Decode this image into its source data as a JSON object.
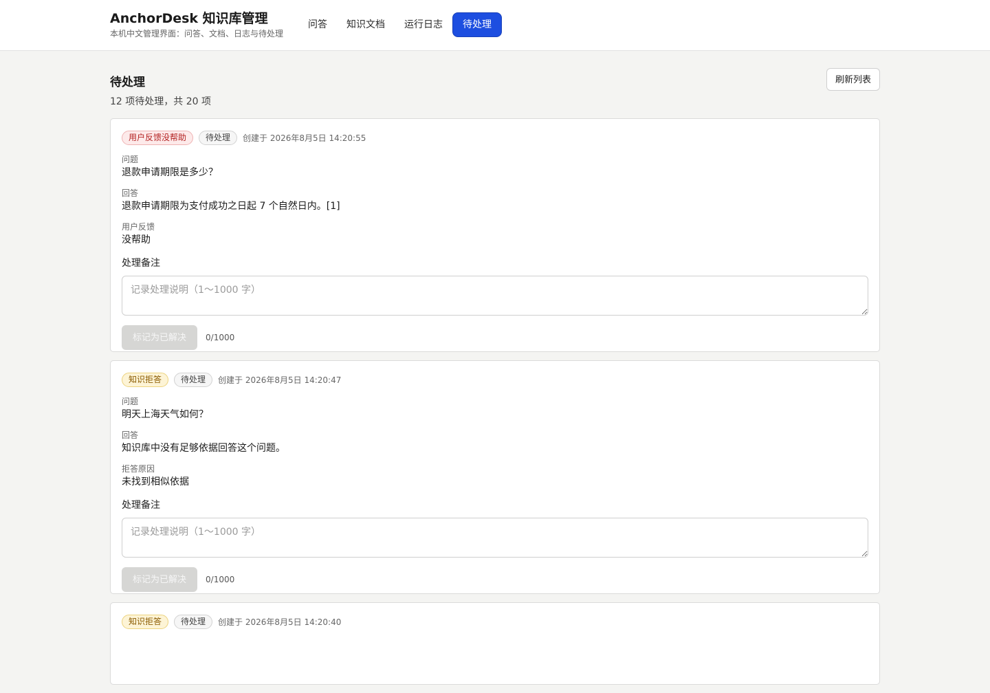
{
  "header": {
    "title": "AnchorDesk 知识库管理",
    "subtitle": "本机中文管理界面：问答、文档、日志与待处理",
    "tabs": [
      {
        "label": "问答",
        "active": false
      },
      {
        "label": "知识文档",
        "active": false
      },
      {
        "label": "运行日志",
        "active": false
      },
      {
        "label": "待处理",
        "active": true
      }
    ],
    "accent_color": "#1d4ee0"
  },
  "page": {
    "title": "待处理",
    "count_text": "12 项待处理，共 20 项",
    "refresh_label": "刷新列表"
  },
  "items": [
    {
      "type_badge": "用户反馈没帮助",
      "type_color": "red",
      "status_badge": "待处理",
      "created": "创建于 2026年8月5日 14:20:55",
      "question_label": "问题",
      "question": "退款申请期限是多少？",
      "answer_label": "回答",
      "answer": "退款申请期限为支付成功之日起 7 个自然日内。[1]",
      "extra_label": "用户反馈",
      "extra": "没帮助",
      "note_label": "处理备注",
      "note_placeholder": "记录处理说明（1～1000 字）",
      "note_value": "",
      "resolve_label": "标记为已解决",
      "char_count": "0/1000"
    },
    {
      "type_badge": "知识拒答",
      "type_color": "yellow",
      "status_badge": "待处理",
      "created": "创建于 2026年8月5日 14:20:47",
      "question_label": "问题",
      "question": "明天上海天气如何？",
      "answer_label": "回答",
      "answer": "知识库中没有足够依据回答这个问题。",
      "extra_label": "拒答原因",
      "extra": "未找到相似依据",
      "note_label": "处理备注",
      "note_placeholder": "记录处理说明（1～1000 字）",
      "note_value": "",
      "resolve_label": "标记为已解决",
      "char_count": "0/1000"
    },
    {
      "type_badge": "知识拒答",
      "type_color": "yellow",
      "status_badge": "待处理",
      "created": "创建于 2026年8月5日 14:20:40"
    }
  ]
}
